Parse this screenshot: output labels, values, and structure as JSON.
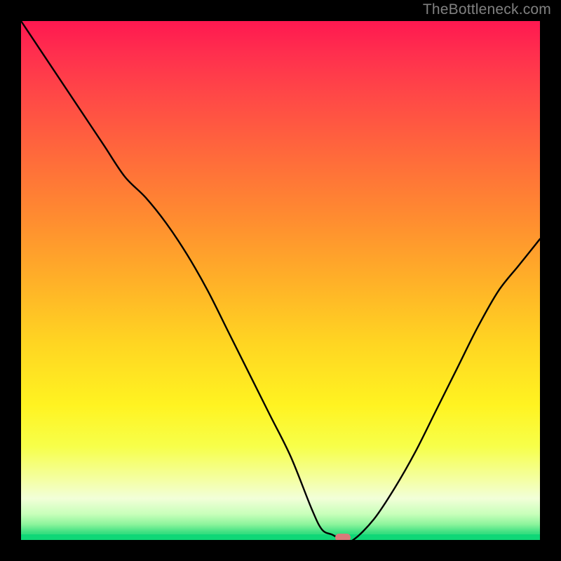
{
  "watermark": "TheBottleneck.com",
  "colors": {
    "frame": "#000000",
    "curve": "#000000",
    "marker": "#d97a7a",
    "watermark": "#808080",
    "gradient_top": "#ff1850",
    "gradient_bottom": "#15d878"
  },
  "chart_data": {
    "type": "line",
    "title": "",
    "xlabel": "",
    "ylabel": "",
    "xlim": [
      0,
      100
    ],
    "ylim": [
      0,
      100
    ],
    "note": "V-shaped bottleneck curve over red→green vertical gradient; curve reaches minimum (green/optimal) near x≈62 where a small salmon marker sits on the baseline. Values are estimates read off the image.",
    "series": [
      {
        "name": "bottleneck-curve",
        "x": [
          0,
          4,
          8,
          12,
          16,
          20,
          24,
          28,
          32,
          36,
          40,
          44,
          48,
          52,
          56,
          58,
          60,
          62,
          64,
          68,
          72,
          76,
          80,
          84,
          88,
          92,
          96,
          100
        ],
        "y": [
          100,
          94,
          88,
          82,
          76,
          70,
          66,
          61,
          55,
          48,
          40,
          32,
          24,
          16,
          6,
          2,
          1,
          0,
          0,
          4,
          10,
          17,
          25,
          33,
          41,
          48,
          53,
          58
        ]
      }
    ],
    "marker": {
      "x": 62,
      "y": 0
    }
  }
}
